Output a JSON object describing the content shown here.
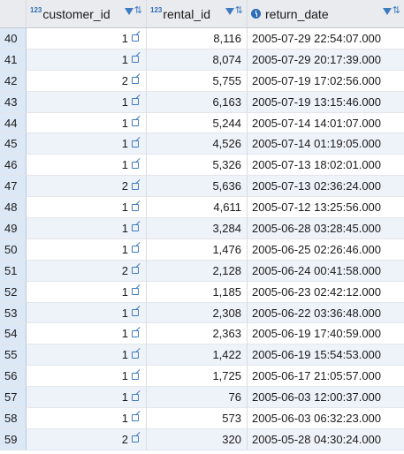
{
  "columns": [
    {
      "name": "customer_id",
      "type_badge": "123"
    },
    {
      "name": "rental_id",
      "type_badge": "123"
    },
    {
      "name": "return_date",
      "type_badge": "clock-icon"
    }
  ],
  "rows": [
    {
      "n": "40",
      "customer_id": "1",
      "rental_id": "8,116",
      "return_date": "2005-07-29 22:54:07.000"
    },
    {
      "n": "41",
      "customer_id": "1",
      "rental_id": "8,074",
      "return_date": "2005-07-29 20:17:39.000"
    },
    {
      "n": "42",
      "customer_id": "2",
      "rental_id": "5,755",
      "return_date": "2005-07-19 17:02:56.000"
    },
    {
      "n": "43",
      "customer_id": "1",
      "rental_id": "6,163",
      "return_date": "2005-07-19 13:15:46.000"
    },
    {
      "n": "44",
      "customer_id": "1",
      "rental_id": "5,244",
      "return_date": "2005-07-14 14:01:07.000"
    },
    {
      "n": "45",
      "customer_id": "1",
      "rental_id": "4,526",
      "return_date": "2005-07-14 01:19:05.000"
    },
    {
      "n": "46",
      "customer_id": "1",
      "rental_id": "5,326",
      "return_date": "2005-07-13 18:02:01.000"
    },
    {
      "n": "47",
      "customer_id": "2",
      "rental_id": "5,636",
      "return_date": "2005-07-13 02:36:24.000"
    },
    {
      "n": "48",
      "customer_id": "1",
      "rental_id": "4,611",
      "return_date": "2005-07-12 13:25:56.000"
    },
    {
      "n": "49",
      "customer_id": "1",
      "rental_id": "3,284",
      "return_date": "2005-06-28 03:28:45.000"
    },
    {
      "n": "50",
      "customer_id": "1",
      "rental_id": "1,476",
      "return_date": "2005-06-25 02:26:46.000"
    },
    {
      "n": "51",
      "customer_id": "2",
      "rental_id": "2,128",
      "return_date": "2005-06-24 00:41:58.000"
    },
    {
      "n": "52",
      "customer_id": "1",
      "rental_id": "1,185",
      "return_date": "2005-06-23 02:42:12.000"
    },
    {
      "n": "53",
      "customer_id": "1",
      "rental_id": "2,308",
      "return_date": "2005-06-22 03:36:48.000"
    },
    {
      "n": "54",
      "customer_id": "1",
      "rental_id": "2,363",
      "return_date": "2005-06-19 17:40:59.000"
    },
    {
      "n": "55",
      "customer_id": "1",
      "rental_id": "1,422",
      "return_date": "2005-06-19 15:54:53.000"
    },
    {
      "n": "56",
      "customer_id": "1",
      "rental_id": "1,725",
      "return_date": "2005-06-17 21:05:57.000"
    },
    {
      "n": "57",
      "customer_id": "1",
      "rental_id": "76",
      "return_date": "2005-06-03 12:00:37.000"
    },
    {
      "n": "58",
      "customer_id": "1",
      "rental_id": "573",
      "return_date": "2005-06-03 06:32:23.000"
    },
    {
      "n": "59",
      "customer_id": "2",
      "rental_id": "320",
      "return_date": "2005-05-28 04:30:24.000"
    }
  ]
}
